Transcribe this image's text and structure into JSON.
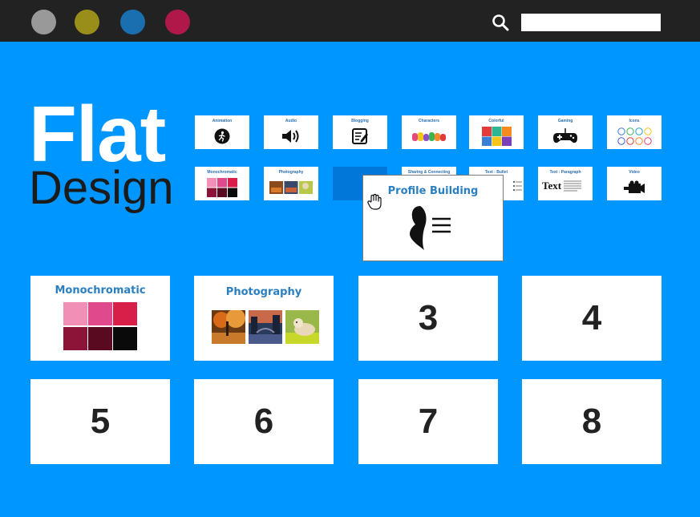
{
  "window_dots": [
    {
      "name": "gray",
      "color": "#999999"
    },
    {
      "name": "olive",
      "color": "#9a8e1a"
    },
    {
      "name": "blue",
      "color": "#1a6fb0"
    },
    {
      "name": "crimson",
      "color": "#b0184a"
    }
  ],
  "search": {
    "icon": "search-icon",
    "placeholder": "",
    "value": ""
  },
  "hero": {
    "line1": "Flat",
    "line2": "Design"
  },
  "templates": [
    {
      "label": "Animation",
      "icon": "running-figure-icon"
    },
    {
      "label": "Audio",
      "icon": "speaker-icon"
    },
    {
      "label": "Blogging",
      "icon": "notepad-pencil-icon"
    },
    {
      "label": "Characters",
      "icon": "characters-icon"
    },
    {
      "label": "Colorful",
      "icon": "color-grid-icon"
    },
    {
      "label": "Gaming",
      "icon": "gamepad-icon"
    },
    {
      "label": "Icons",
      "icon": "social-icons-icon"
    },
    {
      "label": "Monochromatic",
      "icon": "swatches-icon"
    },
    {
      "label": "Photography",
      "icon": "photos-icon"
    },
    {
      "label": "",
      "icon": "empty-slot"
    },
    {
      "label": "Sharing & Connecting",
      "icon": "share-icon"
    },
    {
      "label": "Text : Bullet",
      "icon": "bullet-list-icon"
    },
    {
      "label": "Text : Paragraph",
      "icon": "paragraph-icon",
      "big_word": "Text"
    },
    {
      "label": "Video",
      "icon": "video-camera-icon"
    }
  ],
  "drag_preview": {
    "title": "Profile Building",
    "icon": "profile-list-icon",
    "cursor": "hand-grab-icon"
  },
  "slots": {
    "slot1": {
      "title": "Monochromatic",
      "swatches": [
        "#f28fb6",
        "#e04a8c",
        "#d81f4a",
        "#8c1438",
        "#5a0a20",
        "#0a0a0a"
      ]
    },
    "slot2": {
      "title": "Photography",
      "photos": [
        "autumn-park-photo",
        "city-canal-photo",
        "dog-in-grass-photo"
      ]
    },
    "slot3": {
      "number": "3"
    },
    "slot4": {
      "number": "4"
    },
    "slot5": {
      "number": "5"
    },
    "slot6": {
      "number": "6"
    },
    "slot7": {
      "number": "7"
    },
    "slot8": {
      "number": "8"
    }
  },
  "colors": {
    "background": "#0096ff",
    "topbar": "#222222",
    "accent_text": "#2a7fc0"
  }
}
